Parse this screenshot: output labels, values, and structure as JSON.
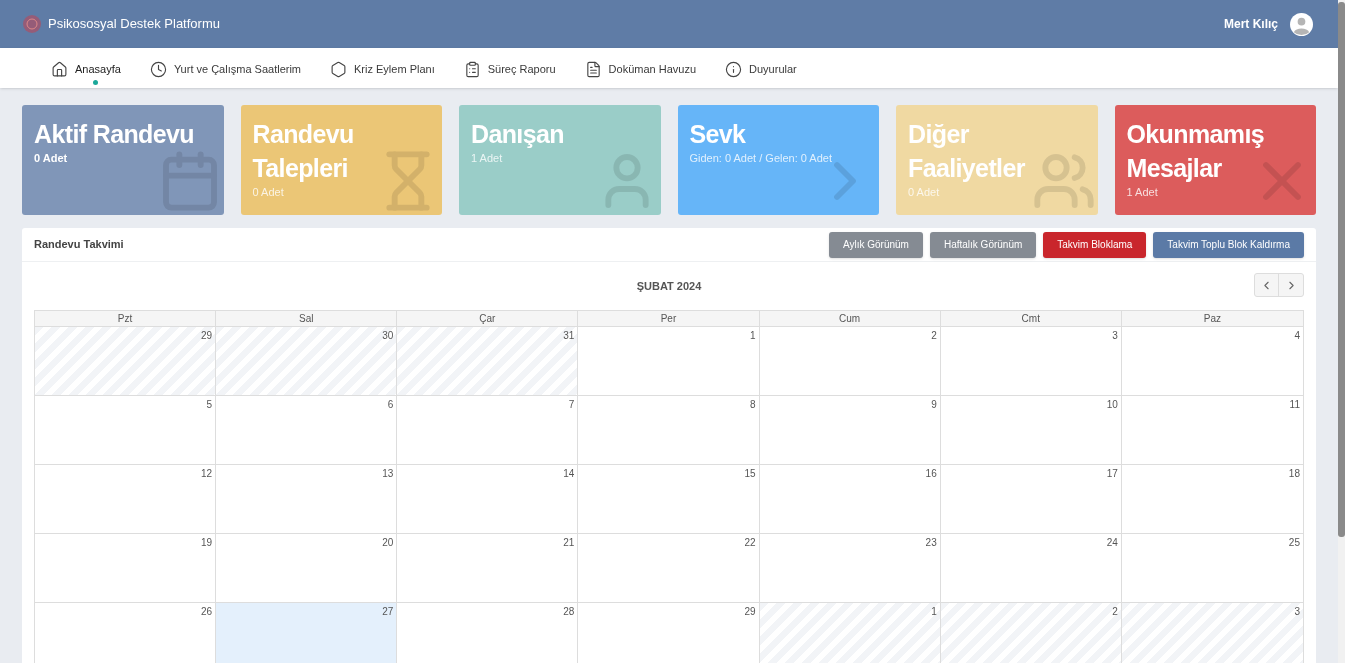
{
  "header": {
    "title": "Psikososyal Destek Platformu",
    "user": "Mert Kılıç"
  },
  "nav": [
    {
      "label": "Anasayfa",
      "kind": "home",
      "selected": true
    },
    {
      "label": "Yurt ve Çalışma Saatlerim",
      "kind": "clock",
      "selected": false
    },
    {
      "label": "Kriz Eylem Planı",
      "kind": "hexagon",
      "selected": false
    },
    {
      "label": "Süreç Raporu",
      "kind": "clipboard",
      "selected": false
    },
    {
      "label": "Doküman Havuzu",
      "kind": "file",
      "selected": false
    },
    {
      "label": "Duyurular",
      "kind": "info",
      "selected": false
    }
  ],
  "cards": [
    {
      "title": "Aktif Randevu",
      "sub": "0 Adet",
      "sub_bold": true,
      "color": "#8096b8",
      "kind": "calendar"
    },
    {
      "title": "Randevu Talepleri",
      "sub": "0 Adet",
      "sub_bold": false,
      "color": "#ebc676",
      "kind": "hourglass"
    },
    {
      "title": "Danışan",
      "sub": "1 Adet",
      "sub_bold": false,
      "color": "#9acdc8",
      "kind": "user"
    },
    {
      "title": "Sevk",
      "sub": "Giden: 0 Adet / Gelen: 0 Adet",
      "sub_bold": false,
      "color": "#66b5f8",
      "kind": "chevron"
    },
    {
      "title": "Diğer Faaliyetler",
      "sub": "0 Adet",
      "sub_bold": false,
      "color": "#f0d9a2",
      "kind": "users"
    },
    {
      "title": "Okunmamış Mesajlar",
      "sub": "1 Adet",
      "sub_bold": false,
      "color": "#dc5c5c",
      "kind": "x"
    }
  ],
  "calendar": {
    "title": "Randevu Takvimi",
    "buttons": [
      {
        "label": "Aylık Görünüm",
        "kind": "secondary"
      },
      {
        "label": "Haftalık Görünüm",
        "kind": "secondary"
      },
      {
        "label": "Takvim Bloklama",
        "kind": "danger"
      },
      {
        "label": "Takvim Toplu Blok Kaldırma",
        "kind": "primary"
      }
    ],
    "month": "ŞUBAT 2024",
    "weekdays": [
      "Pzt",
      "Sal",
      "Çar",
      "Per",
      "Cum",
      "Cmt",
      "Paz"
    ],
    "weeks": [
      [
        {
          "day": "29",
          "kind": "other"
        },
        {
          "day": "30",
          "kind": "other"
        },
        {
          "day": "31",
          "kind": "other"
        },
        {
          "day": "1",
          "kind": "current"
        },
        {
          "day": "2",
          "kind": "current"
        },
        {
          "day": "3",
          "kind": "current"
        },
        {
          "day": "4",
          "kind": "current"
        }
      ],
      [
        {
          "day": "5",
          "kind": "current"
        },
        {
          "day": "6",
          "kind": "current"
        },
        {
          "day": "7",
          "kind": "current"
        },
        {
          "day": "8",
          "kind": "current"
        },
        {
          "day": "9",
          "kind": "current"
        },
        {
          "day": "10",
          "kind": "current"
        },
        {
          "day": "11",
          "kind": "current"
        }
      ],
      [
        {
          "day": "12",
          "kind": "current"
        },
        {
          "day": "13",
          "kind": "current"
        },
        {
          "day": "14",
          "kind": "current"
        },
        {
          "day": "15",
          "kind": "current"
        },
        {
          "day": "16",
          "kind": "current"
        },
        {
          "day": "17",
          "kind": "current"
        },
        {
          "day": "18",
          "kind": "current"
        }
      ],
      [
        {
          "day": "19",
          "kind": "current"
        },
        {
          "day": "20",
          "kind": "current"
        },
        {
          "day": "21",
          "kind": "current"
        },
        {
          "day": "22",
          "kind": "current"
        },
        {
          "day": "23",
          "kind": "current"
        },
        {
          "day": "24",
          "kind": "current"
        },
        {
          "day": "25",
          "kind": "current"
        }
      ],
      [
        {
          "day": "26",
          "kind": "current"
        },
        {
          "day": "27",
          "kind": "today"
        },
        {
          "day": "28",
          "kind": "current"
        },
        {
          "day": "29",
          "kind": "current"
        },
        {
          "day": "1",
          "kind": "other"
        },
        {
          "day": "2",
          "kind": "other"
        },
        {
          "day": "3",
          "kind": "other"
        }
      ]
    ]
  }
}
